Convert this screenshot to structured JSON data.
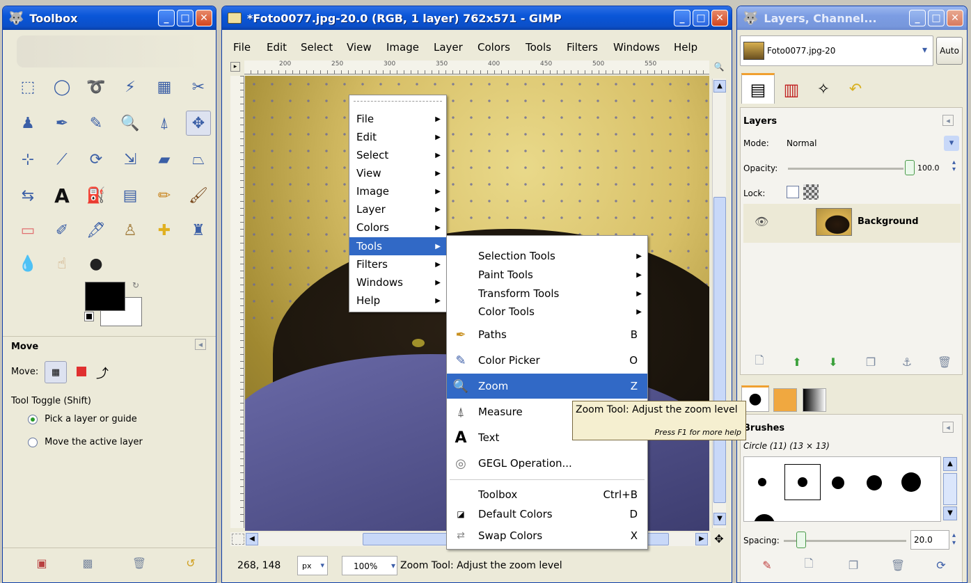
{
  "toolbox": {
    "title": "Toolbox",
    "tool_options_title": "Move",
    "move_label": "Move:",
    "toggle_label": "Tool Toggle  (Shift)",
    "radio1": "Pick a layer or guide",
    "radio2": "Move the active layer"
  },
  "image_window": {
    "title": "*Foto0077.jpg-20.0 (RGB, 1 layer) 762x571 - GIMP",
    "menubar": [
      "File",
      "Edit",
      "Select",
      "View",
      "Image",
      "Layer",
      "Colors",
      "Tools",
      "Filters",
      "Windows",
      "Help"
    ],
    "ruler_ticks": [
      "200",
      "250",
      "300",
      "350",
      "400",
      "450",
      "500",
      "550"
    ],
    "coords": "268, 148",
    "unit": "px",
    "zoom": "100%",
    "status": "Zoom Tool: Adjust the zoom level"
  },
  "context_menu": {
    "items": [
      "File",
      "Edit",
      "Select",
      "View",
      "Image",
      "Layer",
      "Colors",
      "Tools",
      "Filters",
      "Windows",
      "Help"
    ],
    "highlighted": "Tools"
  },
  "tools_submenu": {
    "submenus": [
      "Selection Tools",
      "Paint Tools",
      "Transform Tools",
      "Color Tools"
    ],
    "items": [
      {
        "label": "Paths",
        "key": "B",
        "icon": "paths-icon"
      },
      {
        "label": "Color Picker",
        "key": "O",
        "icon": "color-picker-icon"
      },
      {
        "label": "Zoom",
        "key": "Z",
        "icon": "zoom-icon"
      },
      {
        "label": "Measure",
        "key": "",
        "icon": "measure-icon"
      },
      {
        "label": "Text",
        "key": "",
        "icon": "text-icon"
      },
      {
        "label": "GEGL Operation...",
        "key": "",
        "icon": "gegl-icon"
      }
    ],
    "bottom": [
      {
        "label": "Toolbox",
        "key": "Ctrl+B"
      },
      {
        "label": "Default Colors",
        "key": "D"
      },
      {
        "label": "Swap Colors",
        "key": "X"
      }
    ]
  },
  "tooltip": {
    "title": "Zoom Tool: Adjust the zoom level",
    "hint": "Press F1 for more help"
  },
  "layers_window": {
    "title": "Layers, Channel...",
    "image_select": "Foto0077.jpg-20",
    "auto": "Auto",
    "layers_title": "Layers",
    "mode_label": "Mode:",
    "mode_value": "Normal",
    "opacity_label": "Opacity:",
    "opacity_value": "100.0",
    "lock_label": "Lock:",
    "layer_name": "Background",
    "brushes_title": "Brushes",
    "brush_name": "Circle (11) (13 × 13)",
    "spacing_label": "Spacing:",
    "spacing_value": "20.0"
  },
  "colors": {
    "titlebar": "#0a56d8",
    "menu_highlight": "#3169c6",
    "tooltip_bg": "#f5efd0"
  }
}
